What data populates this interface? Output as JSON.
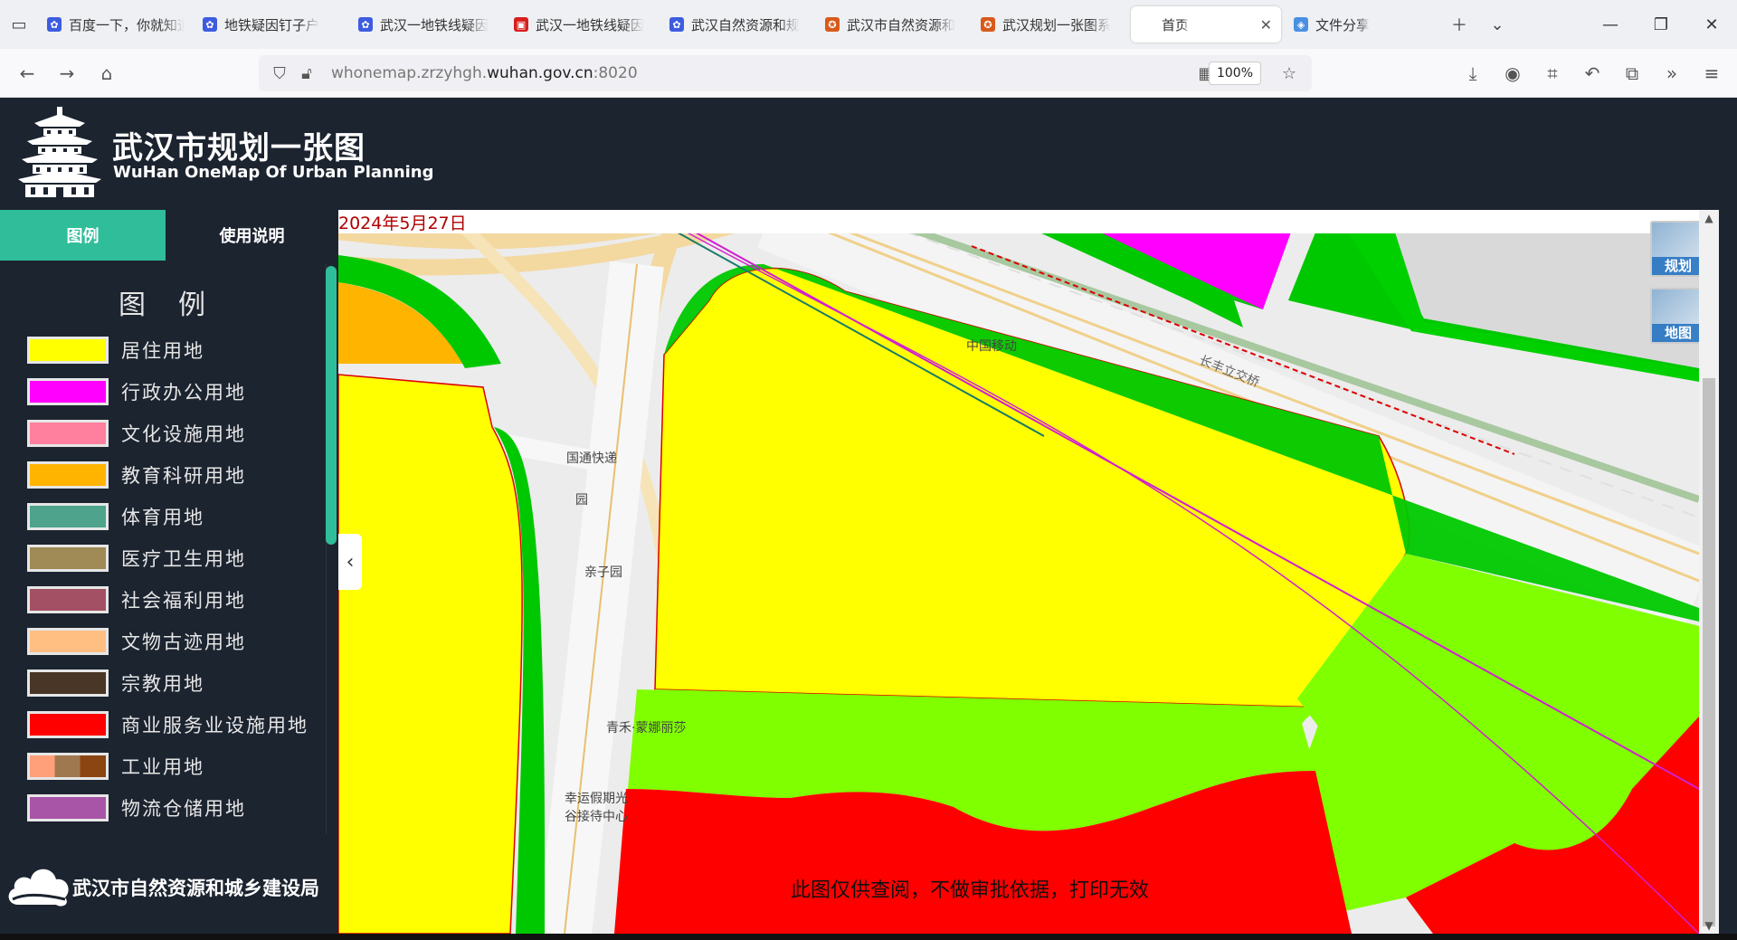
{
  "browser": {
    "tabs": [
      {
        "title": "百度一下，你就知道",
        "fav": "baidu-paw"
      },
      {
        "title": "地铁疑因钉子户",
        "fav": "baidu-paw"
      },
      {
        "title": "武汉一地铁线疑因",
        "fav": "baidu-paw"
      },
      {
        "title": "武汉一地铁线疑因",
        "fav": "news"
      },
      {
        "title": "武汉自然资源和规",
        "fav": "baidu-paw"
      },
      {
        "title": "武汉市自然资源和",
        "fav": "emblem"
      },
      {
        "title": "武汉规划一张图系",
        "fav": "emblem"
      },
      {
        "title": "首页",
        "fav": "none",
        "active": true
      },
      {
        "title": "文件分享",
        "fav": "share"
      }
    ],
    "url_prefix": "whonemap.zrzyhgh.",
    "url_domain": "wuhan.gov.cn",
    "url_suffix": ":8020",
    "zoom": "100%"
  },
  "app": {
    "title": "武汉市规划一张图",
    "subtitle": "WuHan OneMap Of Urban Planning"
  },
  "sidebar": {
    "tabs": [
      "图例",
      "使用说明"
    ],
    "legend_title": "图例",
    "legend": [
      {
        "label": "居住用地",
        "color": "#ffff00"
      },
      {
        "label": "行政办公用地",
        "color": "#ff00ff"
      },
      {
        "label": "文化设施用地",
        "color": "#ff7f9f"
      },
      {
        "label": "教育科研用地",
        "color": "#ffb400"
      },
      {
        "label": "体育用地",
        "color": "#4ea38c"
      },
      {
        "label": "医疗卫生用地",
        "color": "#a08a55"
      },
      {
        "label": "社会福利用地",
        "color": "#a45064"
      },
      {
        "label": "文物古迹用地",
        "color": "#ffbe82"
      },
      {
        "label": "宗教用地",
        "color": "#4a3626"
      },
      {
        "label": "商业服务业设施用地",
        "color": "#ff0000"
      },
      {
        "label": "工业用地",
        "color": "multi"
      },
      {
        "label": "物流仓储用地",
        "color": "#a855a8"
      }
    ],
    "org": "武汉市自然资源和城乡建设局"
  },
  "map": {
    "date": "2024年5月27日",
    "buttons": [
      "规划",
      "地图"
    ],
    "watermark": "此图仅供查阅，不做审批依据，打印无效",
    "labels": [
      "中国移动",
      "国通快递",
      "园",
      "亲子园",
      "青禾·蒙娜丽莎",
      "幸运假期光",
      "谷接待中心",
      "长丰立交桥"
    ]
  }
}
